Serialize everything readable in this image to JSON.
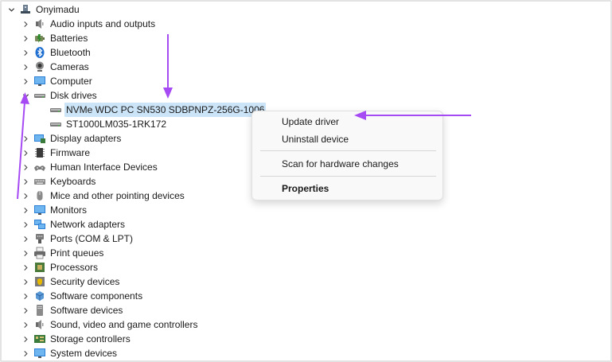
{
  "tree": {
    "root": "Onyimadu",
    "categories": [
      {
        "label": "Audio inputs and outputs",
        "icon": "speaker-icon"
      },
      {
        "label": "Batteries",
        "icon": "battery-icon"
      },
      {
        "label": "Bluetooth",
        "icon": "bluetooth-icon"
      },
      {
        "label": "Cameras",
        "icon": "camera-icon"
      },
      {
        "label": "Computer",
        "icon": "monitor-icon"
      },
      {
        "label": "Disk drives",
        "icon": "disk-drive-icon",
        "expanded": true
      },
      {
        "label": "Display adapters",
        "icon": "display-adapter-icon"
      },
      {
        "label": "Firmware",
        "icon": "chip-icon"
      },
      {
        "label": "Human Interface Devices",
        "icon": "hid-icon"
      },
      {
        "label": "Keyboards",
        "icon": "keyboard-icon"
      },
      {
        "label": "Mice and other pointing devices",
        "icon": "mouse-icon"
      },
      {
        "label": "Monitors",
        "icon": "monitor-icon"
      },
      {
        "label": "Network adapters",
        "icon": "network-icon"
      },
      {
        "label": "Ports (COM & LPT)",
        "icon": "port-icon"
      },
      {
        "label": "Print queues",
        "icon": "printer-icon"
      },
      {
        "label": "Processors",
        "icon": "processor-icon"
      },
      {
        "label": "Security devices",
        "icon": "security-icon"
      },
      {
        "label": "Software components",
        "icon": "software-component-icon"
      },
      {
        "label": "Software devices",
        "icon": "software-device-icon"
      },
      {
        "label": "Sound, video and game controllers",
        "icon": "speaker-icon"
      },
      {
        "label": "Storage controllers",
        "icon": "storage-controller-icon"
      },
      {
        "label": "System devices",
        "icon": "system-device-icon"
      }
    ],
    "disk_children": [
      {
        "label": "NVMe WDC PC SN530 SDBPNPZ-256G-1006",
        "selected": true
      },
      {
        "label": "ST1000LM035-1RK172",
        "selected": false
      }
    ]
  },
  "context_menu": {
    "update_driver": "Update driver",
    "uninstall_device": "Uninstall device",
    "scan": "Scan for hardware changes",
    "properties": "Properties"
  },
  "colors": {
    "selection": "#cce4f7",
    "annotation_arrow": "#a64bf4"
  }
}
